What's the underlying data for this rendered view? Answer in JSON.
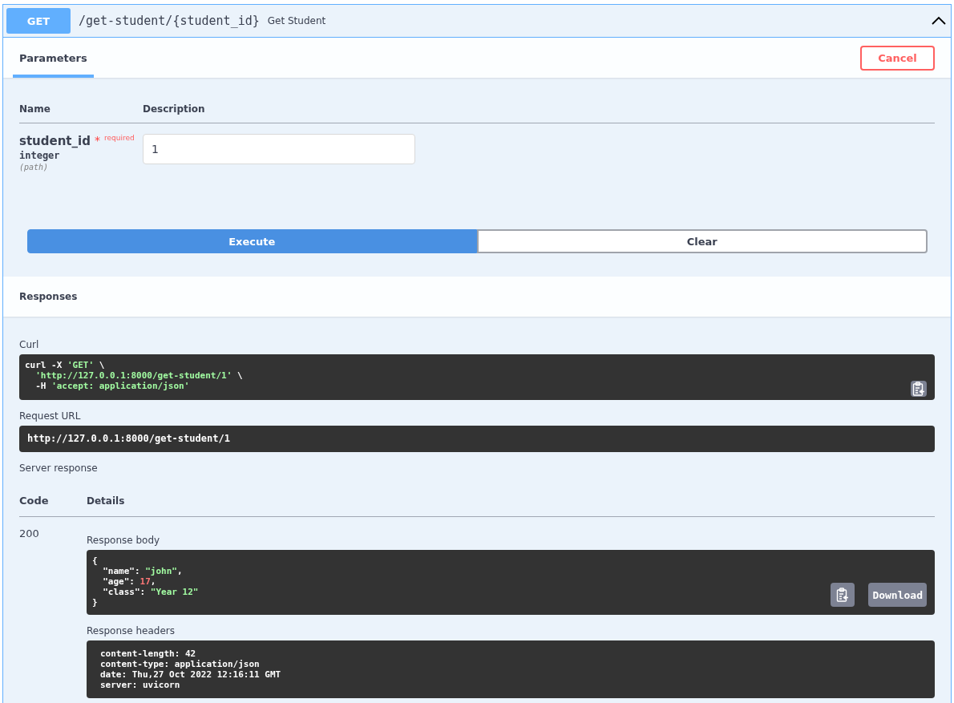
{
  "operation": {
    "method": "GET",
    "path": "/get-student/{student_id}",
    "summary": "Get Student",
    "expanded": true
  },
  "tabs": [
    {
      "label": "Parameters",
      "selected": true
    }
  ],
  "cancel_button": "Cancel",
  "parameters": {
    "columns": [
      "Name",
      "Description"
    ],
    "rows": [
      {
        "name": "student_id",
        "required_mark": "*",
        "required_label": "required",
        "type": "integer",
        "location": "(path)",
        "value": "1"
      }
    ]
  },
  "actions": [
    {
      "label": "Execute",
      "kind": "primary"
    },
    {
      "label": "Clear",
      "kind": "secondary"
    }
  ],
  "responses": {
    "title": "Responses",
    "curl": {
      "label": "Curl",
      "lines": [
        [
          {
            "kind": "plain",
            "text": "curl -X "
          },
          {
            "kind": "string",
            "text": "'GET'"
          },
          {
            "kind": "plain",
            "text": " \\"
          }
        ],
        [
          {
            "kind": "indent"
          },
          {
            "kind": "string",
            "text": "'http://127.0.0.1:8000/get-student/1'"
          },
          {
            "kind": "plain",
            "text": " \\"
          }
        ],
        [
          {
            "kind": "plain",
            "text": "  -H "
          },
          {
            "kind": "string",
            "text": "'accept: application/json'"
          }
        ]
      ]
    },
    "request_url": {
      "label": "Request URL",
      "value": "http://127.0.0.1:8000/get-student/1"
    },
    "server_response": {
      "label": "Server response",
      "columns": [
        "Code",
        "Details"
      ],
      "code": "200",
      "body": {
        "label": "Response body",
        "download_button": "Download",
        "lines": [
          [
            {
              "kind": "plain",
              "text": "{"
            }
          ],
          [
            {
              "kind": "plain",
              "text": "  \"name\": "
            },
            {
              "kind": "string",
              "text": "\"john\""
            },
            {
              "kind": "plain",
              "text": ","
            }
          ],
          [
            {
              "kind": "plain",
              "text": "  \"age\": "
            },
            {
              "kind": "number",
              "text": "17"
            },
            {
              "kind": "plain",
              "text": ","
            }
          ],
          [
            {
              "kind": "plain",
              "text": "  \"class\": "
            },
            {
              "kind": "string",
              "text": "\"Year 12\""
            }
          ],
          [
            {
              "kind": "plain",
              "text": "}"
            }
          ]
        ]
      },
      "headers": {
        "label": "Response headers",
        "lines": [
          "content-length: 42",
          "content-type: application/json",
          "date: Thu,27 Oct 2022 12:16:11 GMT",
          "server: uvicorn"
        ]
      }
    }
  }
}
